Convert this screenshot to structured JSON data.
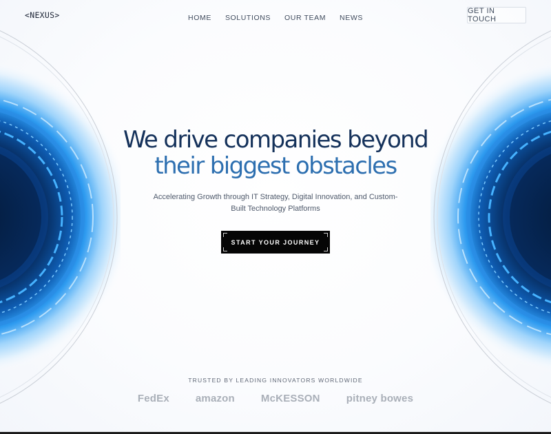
{
  "logo": "<NEXUS>",
  "nav": [
    "HOME",
    "SOLUTIONS",
    "OUR TEAM",
    "NEWS"
  ],
  "cta_top": "GET IN TOUCH",
  "hero": {
    "line1": "We drive companies beyond",
    "line2": "their biggest obstacles",
    "subtitle": "Accelerating Growth through IT Strategy, Digital Innovation, and Custom-Built Technology Platforms",
    "button": "START YOUR JOURNEY"
  },
  "trusted": {
    "label": "TRUSTED BY LEADING INNOVATORS WORLDWIDE",
    "brands": [
      "FedEx",
      "amazon",
      "McKESSON",
      "pitney bowes"
    ]
  },
  "colors": {
    "title_dark": "#14315a",
    "title_blue": "#2d6fb0",
    "ring_blue": "#1e7fd8",
    "button_bg": "#050505"
  }
}
